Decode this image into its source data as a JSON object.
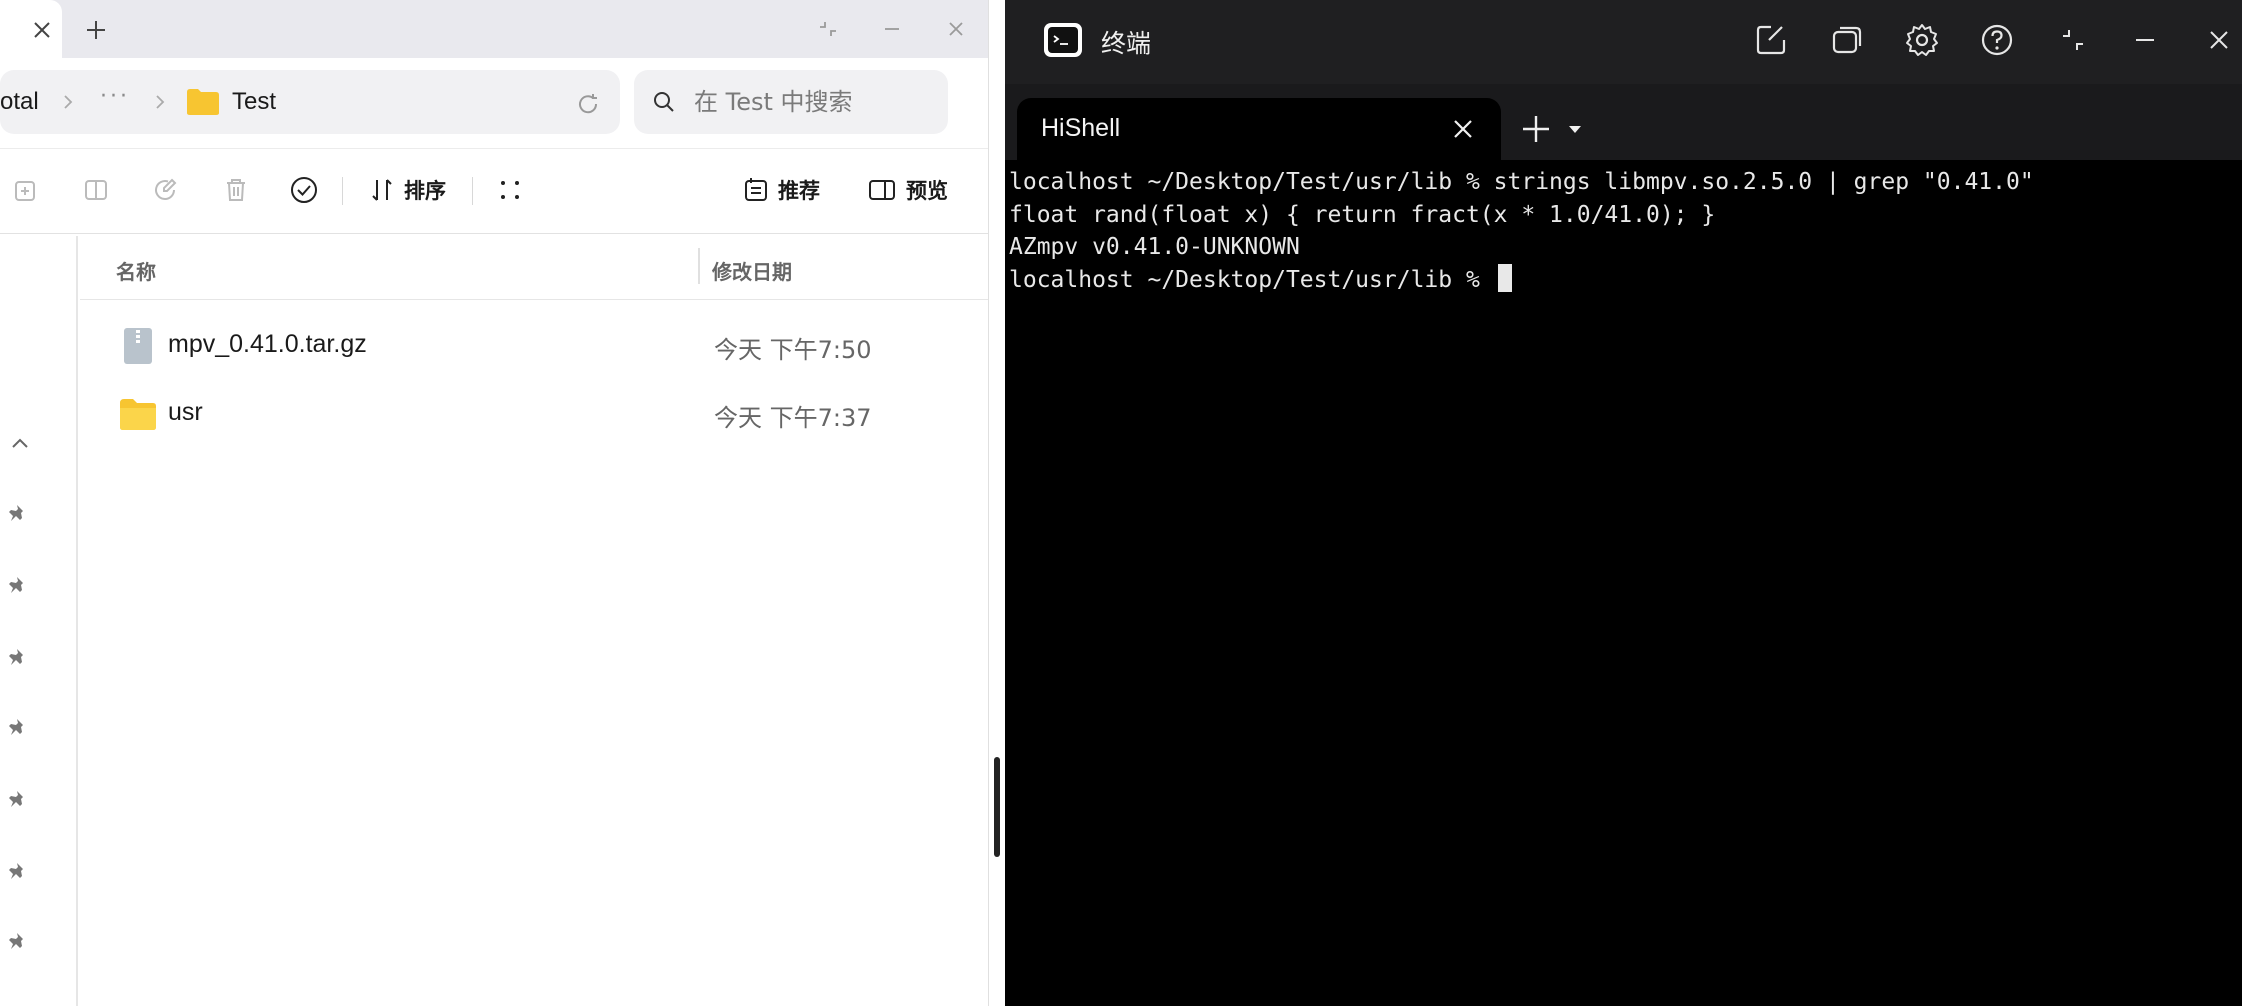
{
  "file_manager": {
    "search": {
      "placeholder": "在 Test 中搜索"
    },
    "breadcrumb": {
      "first": "otal",
      "more": "···",
      "current": "Test"
    },
    "toolbar": {
      "sort_label": "排序",
      "recommend_label": "推荐",
      "preview_label": "预览"
    },
    "columns": {
      "name": "名称",
      "date": "修改日期"
    },
    "files": [
      {
        "name": "mpv_0.41.0.tar.gz",
        "date": "今天 下午7:50",
        "icon": "archive-file-icon"
      },
      {
        "name": "usr",
        "date": "今天 下午7:37",
        "icon": "folder-icon"
      }
    ]
  },
  "terminal": {
    "window_title": "终端",
    "tab_label": "HiShell",
    "lines": [
      "localhost ~/Desktop/Test/usr/lib % strings libmpv.so.2.5.0 | grep \"0.41.0\"",
      "float rand(float x) { return fract(x * 1.0/41.0); }",
      "AZmpv v0.41.0-UNKNOWN",
      "localhost ~/Desktop/Test/usr/lib % "
    ]
  },
  "colors": {
    "terminal_bg": "#000000",
    "title_bar": "#1f1f21",
    "folder": "#f7c531",
    "accent_text": "#1a1a1a"
  }
}
